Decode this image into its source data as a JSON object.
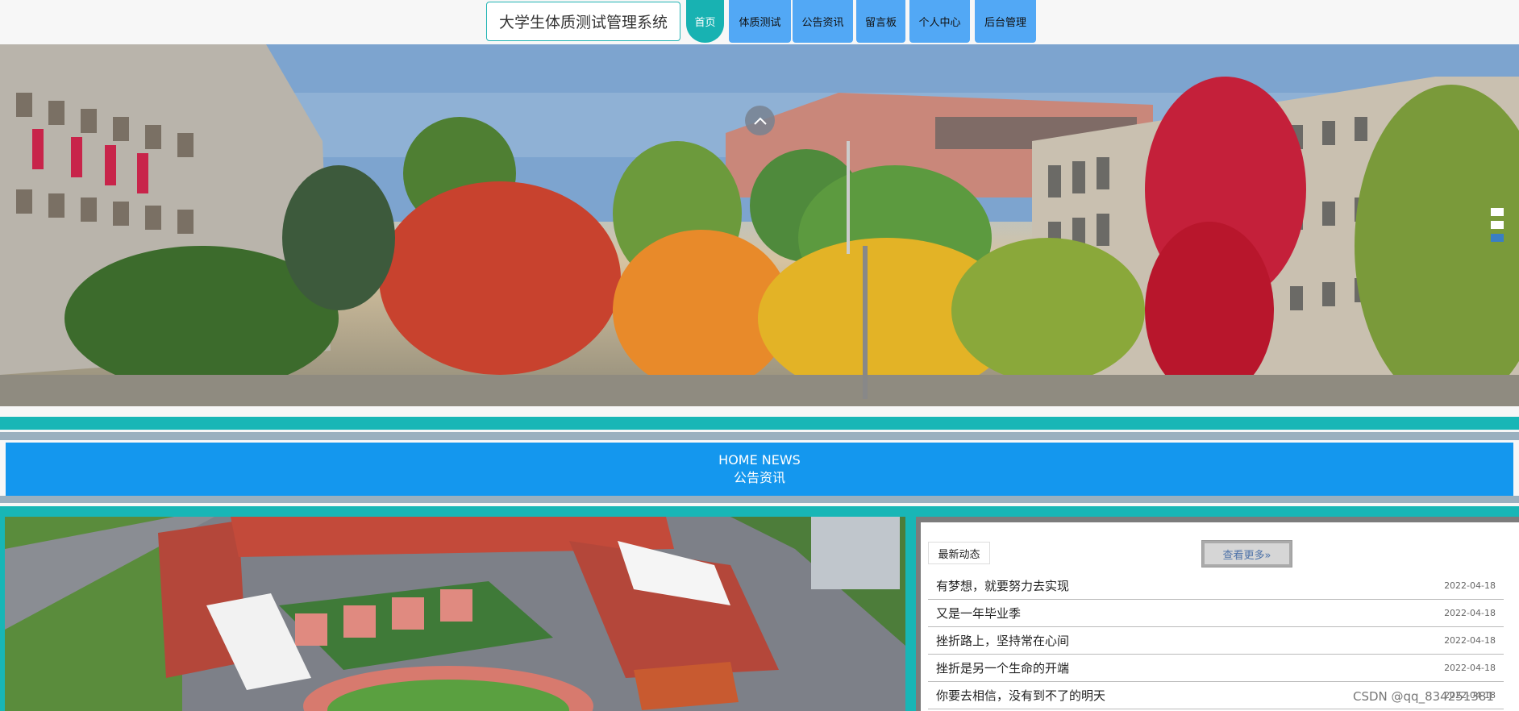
{
  "site": {
    "title": "大学生体质测试管理系统"
  },
  "nav": [
    {
      "label": "首页"
    },
    {
      "label": "体质测试"
    },
    {
      "label": "公告资讯"
    },
    {
      "label": "留言板"
    },
    {
      "label": "个人中心"
    },
    {
      "label": "后台管理"
    }
  ],
  "carousel": {
    "active_index": 2,
    "slide_count": 3
  },
  "news_section": {
    "title_en": "HOME NEWS",
    "title_cn": "公告资讯"
  },
  "news_panel": {
    "tag": "最新动态",
    "more_label": "查看更多»",
    "items": [
      {
        "title": "有梦想，就要努力去实现",
        "date": "2022-04-18"
      },
      {
        "title": "又是一年毕业季",
        "date": "2022-04-18"
      },
      {
        "title": "挫折路上，坚持常在心间",
        "date": "2022-04-18"
      },
      {
        "title": "挫折是另一个生命的开端",
        "date": "2022-04-18"
      },
      {
        "title": "你要去相信，没有到不了的明天",
        "date": "2022-04-18"
      }
    ]
  },
  "watermark": "CSDN @qq_834251381",
  "colors": {
    "teal": "#18b6b6",
    "blue": "#1497ee",
    "nav_blue": "#52a8f5"
  }
}
